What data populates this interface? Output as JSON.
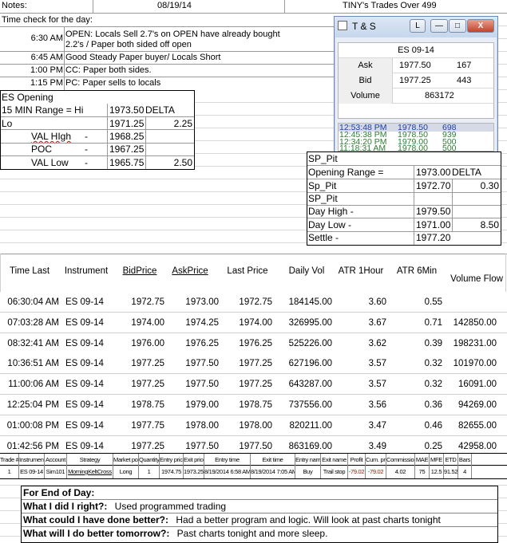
{
  "header": {
    "notes_label": "Notes:",
    "date": "08/19/14",
    "title": "TINY's Trades Over 499"
  },
  "timecheck": {
    "label": "Time check for the day:",
    "rows": [
      {
        "time": "6:30 AM",
        "text1": "OPEN: Locals Sell 2.7's on OPEN have already bought",
        "text2": "2.2's / Paper both sided off open"
      },
      {
        "time": "6:45 AM",
        "text1": "Good Steady Paper buyer/ Locals Short"
      },
      {
        "time": "1:00 PM",
        "text1": "CC: Paper both sides."
      },
      {
        "time": "1:15 PM",
        "text1": "PC: Paper sells to locals"
      }
    ]
  },
  "es_opening": {
    "title": "ES Opening",
    "range_label": "15 MIN Range = Hi",
    "hi_value": "1973.50",
    "delta_label": "DELTA",
    "lo_label": "Lo",
    "lo_value": "1971.25",
    "delta_value": "2.25",
    "val_high_label": "VAL HIgh",
    "val_high_value": "1968.25",
    "poc_label": "POC",
    "poc_value": "1967.25",
    "val_low_label": "VAL Low",
    "val_low_value": "1965.75",
    "val_low_delta": "2.50",
    "dash": "-"
  },
  "ts_window": {
    "title": "T & S",
    "btn_l": "L",
    "btn_min": "—",
    "btn_max": "□",
    "btn_close": "X",
    "symbol": "ES 09-14",
    "ask_label": "Ask",
    "ask_price": "1977.50",
    "ask_size": "167",
    "bid_label": "Bid",
    "bid_price": "1977.25",
    "bid_size": "443",
    "volume_label": "Volume",
    "volume_value": "863172",
    "trades": [
      {
        "time": "12:53:48 PM",
        "price": "1978.50",
        "size": "698"
      },
      {
        "time": "12:45:38 PM",
        "price": "1978.50",
        "size": "939"
      },
      {
        "time": "12:34:20 PM",
        "price": "1979.00",
        "size": "500"
      },
      {
        "time": "11:18:31 AM",
        "price": "1978.00",
        "size": "500"
      }
    ]
  },
  "sp_pit": {
    "title": "SP_Pit",
    "opening_range_label": "Opening Range =",
    "opening_range_value": "1973.00",
    "delta_label": "DELTA",
    "sp_pit_label": "Sp_Pit",
    "sp_pit_value": "1972.70",
    "sp_pit_delta": "0.30",
    "title2": "SP_Pit",
    "day_high_label": "Day High -",
    "day_high_value": "1979.50",
    "day_low_label": "Day Low -",
    "day_low_value": "1971.00",
    "day_low_delta": "8.50",
    "settle_label": "Settle -",
    "settle_value": "1977.20"
  },
  "market_table": {
    "headers": [
      "Time Last",
      "Instrument",
      "BidPrice",
      "AskPrice",
      "Last Price",
      "Daily Vol",
      "ATR 1Hour",
      "ATR 6Min",
      "Volume Flow"
    ],
    "rows": [
      [
        "06:30:04 AM",
        "ES 09-14",
        "1972.75",
        "1973.00",
        "1972.75",
        "184145.00",
        "3.60",
        "0.55",
        ""
      ],
      [
        "07:03:28 AM",
        "ES 09-14",
        "1974.00",
        "1974.25",
        "1974.00",
        "326995.00",
        "3.67",
        "0.71",
        "142850.00"
      ],
      [
        "08:32:41 AM",
        "ES 09-14",
        "1976.00",
        "1976.25",
        "1976.25",
        "525226.00",
        "3.62",
        "0.39",
        "198231.00"
      ],
      [
        "10:36:51 AM",
        "ES 09-14",
        "1977.25",
        "1977.50",
        "1977.25",
        "627196.00",
        "3.57",
        "0.32",
        "101970.00"
      ],
      [
        "11:00:06 AM",
        "ES 09-14",
        "1977.25",
        "1977.50",
        "1977.25",
        "643287.00",
        "3.57",
        "0.32",
        "16091.00"
      ],
      [
        "12:25:04 PM",
        "ES 09-14",
        "1978.75",
        "1979.00",
        "1978.75",
        "737556.00",
        "3.56",
        "0.36",
        "94269.00"
      ],
      [
        "01:00:08 PM",
        "ES 09-14",
        "1977.75",
        "1978.00",
        "1978.00",
        "820211.00",
        "3.47",
        "0.46",
        "82655.00"
      ],
      [
        "01:42:56 PM",
        "ES 09-14",
        "1977.25",
        "1977.50",
        "1977.50",
        "863169.00",
        "3.49",
        "0.25",
        "42958.00"
      ]
    ]
  },
  "trade_table": {
    "headers": [
      "Trade #",
      "Instrument",
      "Account",
      "Strategy",
      "Market pos.",
      "Quantity",
      "Entry price",
      "Exit price",
      "Entry time",
      "Exit time",
      "Entry name",
      "Exit name",
      "Profit",
      "Cum. profit",
      "Commission",
      "MAE",
      "MFE",
      "ETD",
      "Bars"
    ],
    "row": [
      "1",
      "ES 09-14",
      "Sim101",
      "MorningKeltCross",
      "Long",
      "1",
      "1974.75",
      "1973.25",
      "8/19/2014 6:58 AM",
      "8/19/2014 7:05 AM",
      "Buy",
      "Trail stop",
      "-79.02",
      "-79.02",
      "4.02",
      "75",
      "12.5",
      "91.52",
      "4"
    ]
  },
  "end_of_day": {
    "title": "For End of Day:",
    "q1": "What I did I right?:",
    "a1": "Used programmed trading",
    "q2": "What could I have done better?:",
    "a2": "Had a better program and logic.  Will look at past charts tonight",
    "q3": "What will I do better tomorrow?:",
    "a3": "Past charts tonight and more sleep."
  }
}
